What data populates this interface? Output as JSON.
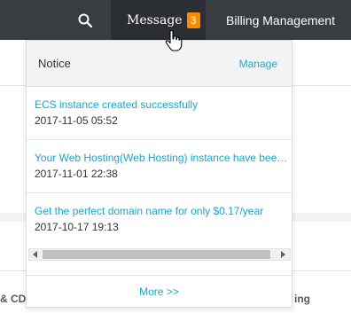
{
  "topbar": {
    "search_icon": "search-icon",
    "message_label": "Message",
    "message_count": "3",
    "billing_label": "Billing Management"
  },
  "notice_panel": {
    "title": "Notice",
    "manage_label": "Manage",
    "items": [
      {
        "title": "ECS instance created successfully",
        "time": "2017-11-05 05:52"
      },
      {
        "title": "Your Web Hosting(Web Hosting) instance have been released",
        "time": "2017-11-01 22:38"
      },
      {
        "title": "Get the perfect domain name for only $0.17/year",
        "time": "2017-10-17 19:13"
      }
    ],
    "more_label": "More >>"
  },
  "background": {
    "left_text": "& CDN",
    "right_text": "ing"
  },
  "colors": {
    "topbar_bg": "#383d41",
    "message_active_bg": "#2b2f33",
    "badge": "#ff8a00",
    "link": "#19a6c8"
  }
}
